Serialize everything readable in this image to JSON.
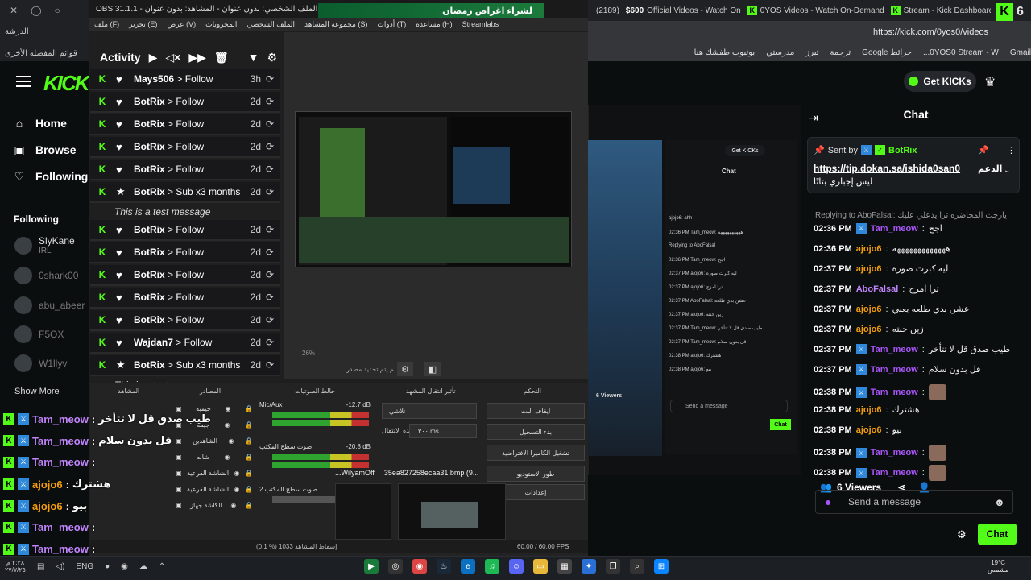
{
  "top": {
    "left_strip": [
      "✕",
      "◯",
      "○"
    ],
    "obs_title": "OBS 31.1.1 - الملف الشخصي: بدون عنوان - المشاهد: بدون عنوان",
    "ramadan_banner": "لشراء اغراض رمضان",
    "chrome_tabs": [
      "(2189)",
      "$600",
      "Official Videos - Watch On",
      "0YOS Videos - Watch On-Demand",
      "Stream - Kick Dashboard"
    ],
    "corner_number": "6",
    "address_url": "https://kick.com/0yos0/videos",
    "bookmarks": [
      "Gmail",
      "0YOS0 Stream - W...",
      "خرائط Google",
      "ترجمة",
      "تيرز",
      "مدرستي",
      "يوتيوب طفشك هنا"
    ],
    "left_address_lines": [
      "الدرشة",
      "قوائم المفضلة الأخرى"
    ]
  },
  "obs": {
    "menu": [
      "ملف (F)",
      "تحرير (E)",
      "عرض (V)",
      "المجرويات",
      "الملف الشخصي",
      "مجموعة المشاهد (S)",
      "أدوات (T)",
      "مساعدة (H)",
      "Streamlabs"
    ],
    "zoom": "26%",
    "preview_hint": "لم يتم تحديد مصدر",
    "docks": {
      "scenes_title": "المشاهد",
      "sources_title": "المصادر",
      "mixer_title": "خالط الصوتيات",
      "transitions_title": "تأثير انتقال المشهد",
      "controls_title": "التحكم",
      "sources": [
        "جيمبه",
        "جيمه",
        "الشاهدين",
        "شانه",
        "الشاشة الفرعية",
        "الشاشة الفرعية",
        "الكاشة جهاز"
      ],
      "mixer": [
        {
          "name": "Mic/Aux",
          "db": "-12.7 dB"
        },
        {
          "name": "صوت سطح المكتب",
          "db": "-20.8 dB"
        },
        {
          "name": "صوت سطح المكتب 2",
          "db": ""
        }
      ],
      "transition": "تلاشي",
      "duration_label": "مدة الانتقال",
      "duration": "٣٠٠ ms",
      "controls": [
        "ايقاف البث",
        "بدء التسجيل",
        "تشغيل الكاميرا الافتراضية",
        "طور الاستوديو",
        "إعدادات"
      ],
      "thumb_labels": [
        "...WilyamOff",
        "35ea827258ecaa31.bmp (9..."
      ],
      "status_left": "(0.1 %) إسقاط المشاهد 1033",
      "status_right": "60.00 / 60.00 FPS"
    }
  },
  "activity": {
    "title": "Activity",
    "rows": [
      {
        "user": "Mays506",
        "action": "Follow",
        "time": "3h",
        "icon": "heart"
      },
      {
        "user": "BotRix",
        "action": "Follow",
        "time": "2d",
        "icon": "heart"
      },
      {
        "user": "BotRix",
        "action": "Follow",
        "time": "2d",
        "icon": "heart"
      },
      {
        "user": "BotRix",
        "action": "Follow",
        "time": "2d",
        "icon": "heart"
      },
      {
        "user": "BotRix",
        "action": "Follow",
        "time": "2d",
        "icon": "heart"
      },
      {
        "user": "BotRix",
        "action": "Sub x3 months",
        "time": "2d",
        "icon": "star",
        "message": "This is a test message"
      },
      {
        "user": "BotRix",
        "action": "Follow",
        "time": "2d",
        "icon": "heart"
      },
      {
        "user": "BotRix",
        "action": "Follow",
        "time": "2d",
        "icon": "heart"
      },
      {
        "user": "BotRix",
        "action": "Follow",
        "time": "2d",
        "icon": "heart"
      },
      {
        "user": "BotRix",
        "action": "Follow",
        "time": "2d",
        "icon": "heart"
      },
      {
        "user": "BotRix",
        "action": "Follow",
        "time": "2d",
        "icon": "heart"
      },
      {
        "user": "Wajdan7",
        "action": "Follow",
        "time": "2d",
        "icon": "heart"
      },
      {
        "user": "BotRix",
        "action": "Sub x3 months",
        "time": "2d",
        "icon": "star",
        "message": "This is a test message"
      }
    ]
  },
  "kick": {
    "nav": [
      "Home",
      "Browse",
      "Following"
    ],
    "following_title": "Following",
    "following": [
      {
        "name": "SlyKane",
        "sub": "IRL"
      },
      {
        "name": "0shark00",
        "sub": ""
      },
      {
        "name": "abu_abeer",
        "sub": ""
      },
      {
        "name": "F5OX",
        "sub": ""
      },
      {
        "name": "W1llyv",
        "sub": ""
      }
    ],
    "show_more": "Show More",
    "get_kicks": "Get KICKs",
    "chat_title": "Chat",
    "pinned": {
      "sent_by": "Sent by",
      "user": "BotRix",
      "link": "https://tip.dokan.sa/ishida0san0",
      "link_suffix": "الدعم",
      "arabic": "ليس إجباري بتاتًا"
    },
    "reply_note": "Replying to AboFalsal: يارجت المحاضره ترا يدعلي عليك",
    "messages": [
      {
        "time": "02:36 PM",
        "user": "Tam_meow",
        "mod": true,
        "color": "#a855f7",
        "text": "اجح"
      },
      {
        "time": "02:36 PM",
        "user": "ajojo6",
        "mod": false,
        "color": "#f59e0b",
        "text": "هههههههههههههه"
      },
      {
        "time": "02:37 PM",
        "user": "ajojo6",
        "mod": false,
        "color": "#f59e0b",
        "text": "ليه كبرت صوره"
      },
      {
        "time": "02:37 PM",
        "user": "AboFalsal",
        "mod": false,
        "color": "#c084fc",
        "text": "ترا امزح"
      },
      {
        "time": "02:37 PM",
        "user": "ajojo6",
        "mod": false,
        "color": "#f59e0b",
        "text": "عشن بدي طلعه يعني"
      },
      {
        "time": "02:37 PM",
        "user": "ajojo6",
        "mod": false,
        "color": "#f59e0b",
        "text": "زين حنته"
      },
      {
        "time": "02:37 PM",
        "user": "Tam_meow",
        "mod": true,
        "color": "#a855f7",
        "text": "طيب صدق قل لا تتأخر"
      },
      {
        "time": "02:37 PM",
        "user": "Tam_meow",
        "mod": true,
        "color": "#a855f7",
        "text": "قل بدون سلام"
      },
      {
        "time": "02:38 PM",
        "user": "Tam_meow",
        "mod": true,
        "color": "#a855f7",
        "text": "",
        "emote": true
      },
      {
        "time": "02:38 PM",
        "user": "ajojo6",
        "mod": false,
        "color": "#f59e0b",
        "text": "هشترك"
      },
      {
        "time": "02:38 PM",
        "user": "ajojo6",
        "mod": false,
        "color": "#f59e0b",
        "text": "بيو"
      },
      {
        "time": "02:38 PM",
        "user": "Tam_meow",
        "mod": true,
        "color": "#a855f7",
        "text": "",
        "emote": true
      },
      {
        "time": "02:38 PM",
        "user": "Tam_meow",
        "mod": true,
        "color": "#a855f7",
        "text": "",
        "emote": true
      }
    ],
    "viewers": "6 Viewers",
    "send_placeholder": "Send a message",
    "chat_button": "Chat"
  },
  "overlay": [
    {
      "user": "Tam_meow",
      "text": "طيب صدق قل لا تتأخر",
      "color": "#c084fc"
    },
    {
      "user": "Tam_meow",
      "text": "قل بدون سلام",
      "color": "#c084fc"
    },
    {
      "user": "Tam_meow",
      "text": "",
      "color": "#c084fc"
    },
    {
      "user": "ajojo6",
      "text": "هشترك",
      "color": "#f59e0b"
    },
    {
      "user": "ajojo6",
      "text": "بيو",
      "color": "#f59e0b"
    },
    {
      "user": "Tam_meow",
      "text": "",
      "color": "#c084fc"
    },
    {
      "user": "Tam_meow",
      "text": "",
      "color": "#c084fc"
    }
  ],
  "mini": {
    "get_kicks": "Get KICKs",
    "chat_title": "Chat",
    "send": "Send a message",
    "chat_btn": "Chat",
    "viewers": "6 Viewers",
    "lines": [
      "ajojo6: ahh",
      "02:36 PM Tam_meow: ههههههههههه",
      "Replying to AboFalsal",
      "02:36 PM Tam_meow: اجح",
      "02:37 PM ajojo6: ليه كبرت صوره",
      "02:37 PM ajojo6: ترا امزح",
      "02:37 PM AboFalsal: عشن بدي طلعه",
      "02:37 PM ajojo6: زين حنته",
      "02:37 PM Tam_meow: طيب صدق قل لا تتأخر",
      "02:37 PM Tam_meow: قل بدون سلام",
      "02:38 PM ajojo6: هشترك",
      "02:38 PM ajojo6: بيو"
    ]
  },
  "taskbar": {
    "time": "٢:٣٨ م",
    "date": "٢٧/٧/٢٥",
    "lang": "ENG",
    "weather_temp": "19°C",
    "weather_desc": "مشمس"
  }
}
